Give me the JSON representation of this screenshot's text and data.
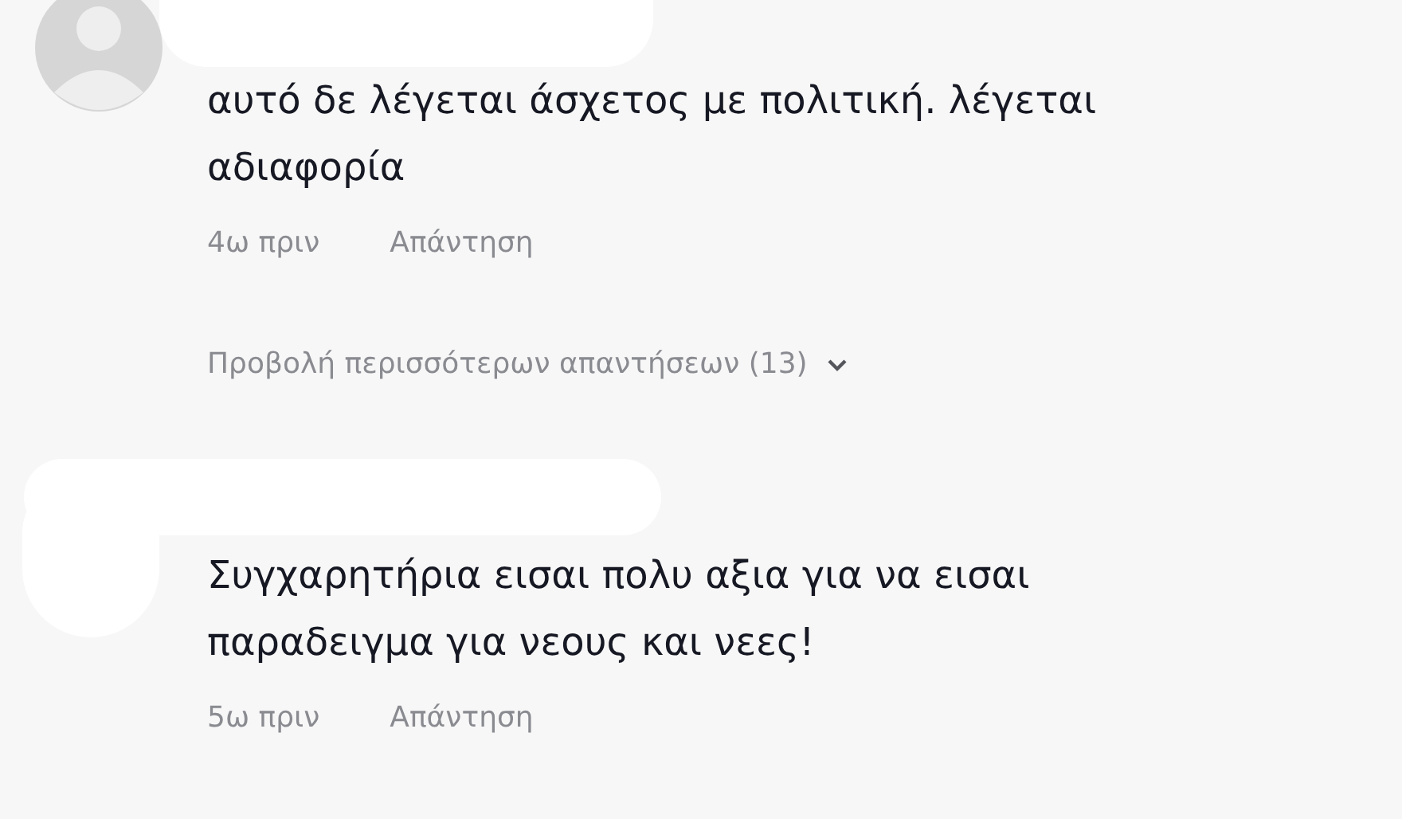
{
  "comments": [
    {
      "text": "αυτό δε λέγεται άσχετος με πολιτική. λέγεται αδιαφορία",
      "time": "4ω πριν",
      "reply": "Απάντηση",
      "avatar_shown": true,
      "more_replies": "Προβολή περισσότερων απαντήσεων (13)"
    },
    {
      "text": "Συγχαρητήρια εισαι πολυ αξια για να εισαι παραδειγμα για νεους και νεες!",
      "time": "5ω πριν",
      "reply": "Απάντηση",
      "avatar_shown": false
    }
  ]
}
